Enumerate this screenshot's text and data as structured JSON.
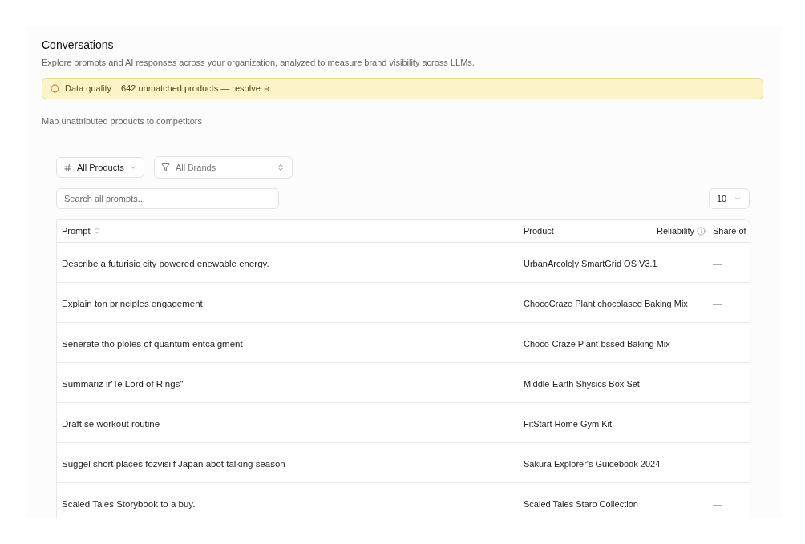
{
  "page": {
    "title": "Conversations",
    "description": "Explore prompts and AI responses across your organization, analyzed to measure brand visibility across LLMs."
  },
  "alert": {
    "label": "Data quality",
    "message": "642 unmatched products — resolve"
  },
  "section": {
    "subtitle": "Map unattributed products to competitors"
  },
  "filters": {
    "product": {
      "value": "All Products"
    },
    "brand": {
      "placeholder": "All Brands"
    },
    "search": {
      "placeholder": "Search all prompts..."
    },
    "page_size": {
      "value": "10"
    }
  },
  "table": {
    "columns": [
      {
        "label": "Prompt",
        "kind": "sortable"
      },
      {
        "label": "Product",
        "kind": "plain"
      },
      {
        "label": "Reliability",
        "kind": "info"
      },
      {
        "label": "Share of",
        "kind": "plain"
      }
    ],
    "rows": [
      {
        "prompt": "Describe a futurisic city powered enewable energy.",
        "product": "UrbanArcolc|y SmartGrid OS V3.1",
        "share": "—"
      },
      {
        "prompt": "Explain ton principles  engagement",
        "product": "ChocoCraze Plant chocolased Baking Mix",
        "share": "—"
      },
      {
        "prompt": "Senerate tho ploles of quantum entcalgment",
        "product": "Choco-Craze Plant-bssed Baking Mix",
        "share": "—"
      },
      {
        "prompt": "Summariz ir'Te Lord of Rings\"",
        "product": "Middle-Earth Shysics Box Set",
        "share": "—"
      },
      {
        "prompt": "Draft se workout routine",
        "product": "FitStart Home Gym Kit",
        "share": "—"
      },
      {
        "prompt": "Suggel short places fozvisilf Japan abot talking season",
        "product": "Sakura Explorer's Guidebook 2024",
        "share": "—"
      },
      {
        "prompt": "Scaled Tales Storybook to a buy.",
        "product": "Scaled Tales Staro Collection",
        "share": "—"
      }
    ]
  }
}
